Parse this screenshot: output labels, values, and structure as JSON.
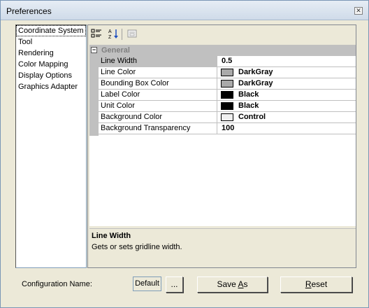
{
  "window": {
    "title": "Preferences",
    "close_label": "✕"
  },
  "categories": [
    "Coordinate System",
    "Tool",
    "Rendering",
    "Color Mapping",
    "Display Options",
    "Graphics Adapter"
  ],
  "toolbar": {
    "categorized_icon": "categorized-icon",
    "alphabetical_icon": "alphabetical-icon",
    "property_pages_icon": "property-pages-icon"
  },
  "grid": {
    "category": {
      "toggle": "−",
      "label": "General"
    },
    "properties": [
      {
        "name": "Line Width",
        "value": "0.5",
        "swatch": null
      },
      {
        "name": "Line Color",
        "value": "DarkGray",
        "swatch": "#a9a9a9"
      },
      {
        "name": "Bounding Box Color",
        "value": "DarkGray",
        "swatch": "#a9a9a9"
      },
      {
        "name": "Label Color",
        "value": "Black",
        "swatch": "#000000"
      },
      {
        "name": "Unit Color",
        "value": "Black",
        "swatch": "#000000"
      },
      {
        "name": "Background Color",
        "value": "Control",
        "swatch": "#f0f0f0"
      },
      {
        "name": "Background Transparency",
        "value": "100",
        "swatch": null
      }
    ]
  },
  "description": {
    "title": "Line Width",
    "text": "Gets or sets gridline width."
  },
  "footer": {
    "config_label": "Configuration Name:",
    "config_value": "Default",
    "browse_label": "...",
    "save_as_prefix": "Save ",
    "save_as_hotkey": "A",
    "save_as_suffix": "s",
    "reset_hotkey": "R",
    "reset_suffix": "eset"
  }
}
